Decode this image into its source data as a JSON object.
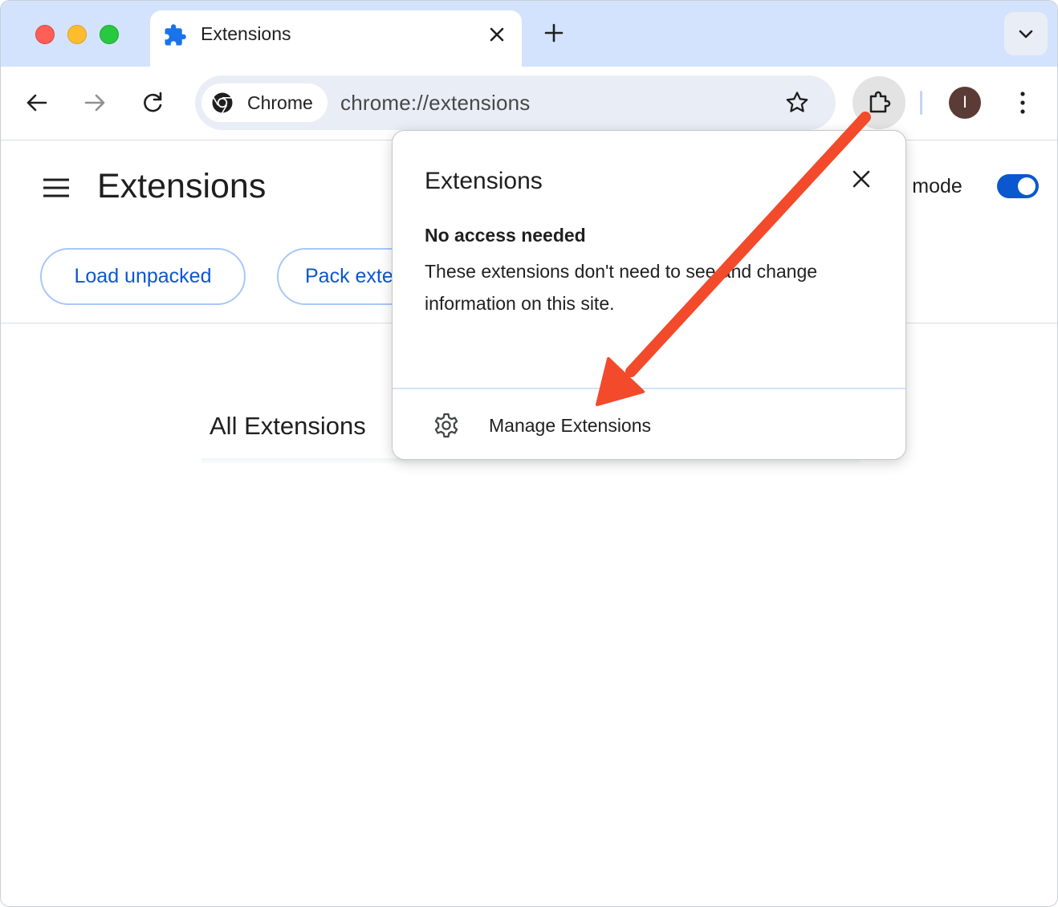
{
  "tab": {
    "title": "Extensions"
  },
  "omnibox": {
    "chip_label": "Chrome",
    "url": "chrome://extensions"
  },
  "avatar": {
    "initial": "I"
  },
  "page": {
    "title": "Extensions",
    "developer_mode_label": "r mode",
    "buttons": {
      "load_unpacked": "Load unpacked",
      "pack_extension": "Pack exte"
    },
    "section_heading": "All Extensions"
  },
  "popup": {
    "title": "Extensions",
    "heading": "No access needed",
    "description": "These extensions don't need to see and change information on this site.",
    "manage_label": "Manage Extensions"
  },
  "colors": {
    "tabstrip": "#d3e3fd",
    "accent_blue": "#0b57d0",
    "annotation_arrow": "#f24a2b"
  },
  "icons": [
    "extension-puzzle-icon",
    "close-icon",
    "plus-icon",
    "chevron-down-icon",
    "back-arrow-icon",
    "forward-arrow-icon",
    "reload-icon",
    "chrome-logo-icon",
    "star-icon",
    "puzzle-icon",
    "kebab-menu-icon",
    "hamburger-icon",
    "gear-icon"
  ]
}
